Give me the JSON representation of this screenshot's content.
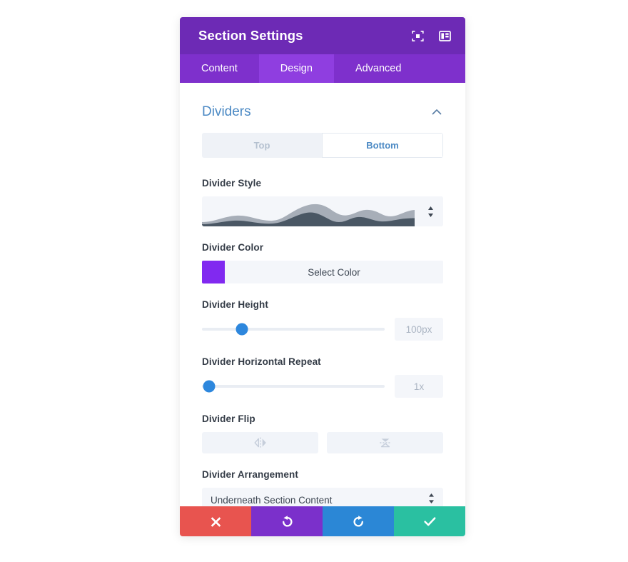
{
  "header": {
    "title": "Section Settings",
    "icons": [
      {
        "name": "focus-target-icon"
      },
      {
        "name": "layout-panel-icon"
      }
    ]
  },
  "tabs": [
    {
      "label": "Content",
      "active": false
    },
    {
      "label": "Design",
      "active": true
    },
    {
      "label": "Advanced",
      "active": false
    }
  ],
  "section": {
    "title": "Dividers",
    "collapse_icon": "chevron-up-icon",
    "expanded": true
  },
  "placement_toggle": {
    "options": [
      {
        "label": "Top",
        "selected": false
      },
      {
        "label": "Bottom",
        "selected": true
      }
    ]
  },
  "fields": {
    "divider_style": {
      "label": "Divider Style",
      "value": "Waves Opacity",
      "preview": "layered-wave-graphic",
      "wave_back_color": "#a7aeb8",
      "wave_front_color": "#4a5764"
    },
    "divider_color": {
      "label": "Divider Color",
      "button_label": "Select Color",
      "swatch_hex": "#8129f0"
    },
    "divider_height": {
      "label": "Divider Height",
      "value": "100px",
      "knob_percent": 22
    },
    "divider_horizontal_repeat": {
      "label": "Divider Horizontal Repeat",
      "value": "1x",
      "knob_percent": 4
    },
    "divider_flip": {
      "label": "Divider Flip",
      "buttons": [
        {
          "name": "flip-horizontal-icon",
          "active": false
        },
        {
          "name": "flip-vertical-icon",
          "active": false
        }
      ]
    },
    "divider_arrangement": {
      "label": "Divider Arrangement",
      "value": "Underneath Section Content"
    }
  },
  "footer": {
    "buttons": [
      {
        "name": "cancel-button",
        "icon": "close-x-icon",
        "color": "#e8544f"
      },
      {
        "name": "undo-button",
        "icon": "undo-icon",
        "color": "#7b30cb"
      },
      {
        "name": "redo-button",
        "icon": "redo-icon",
        "color": "#2b87d6"
      },
      {
        "name": "save-button",
        "icon": "checkmark-icon",
        "color": "#2ac0a1"
      }
    ]
  },
  "theme": {
    "header_purple": "#6d2ab5",
    "tabbar_purple": "#7e30cc",
    "tab_active_purple": "#8f3ee0",
    "accent_blue": "#4b89c4",
    "slider_blue": "#2d87dd"
  }
}
